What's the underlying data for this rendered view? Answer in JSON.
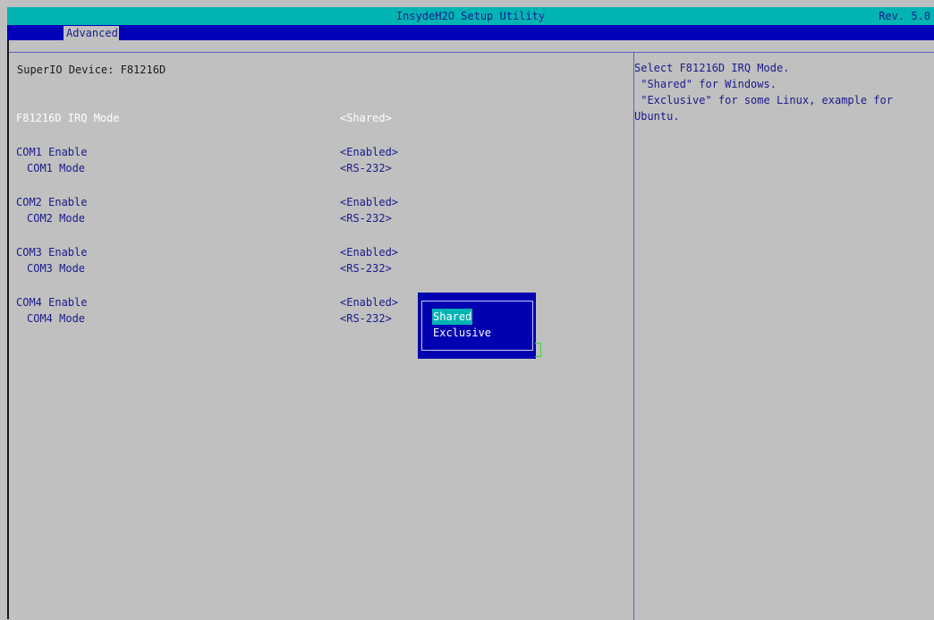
{
  "header": {
    "title": "InsydeH2O Setup Utility",
    "revision": "Rev. 5.0",
    "active_tab": "Advanced"
  },
  "main": {
    "device_title": "SuperIO Device: F81216D",
    "settings": [
      {
        "label": "F81216D IRQ Mode",
        "value": "<Shared>",
        "selected": true,
        "sub": false
      },
      {
        "label": "COM1 Enable",
        "value": "<Enabled>",
        "selected": false,
        "sub": false
      },
      {
        "label": "COM1 Mode",
        "value": "<RS-232>",
        "selected": false,
        "sub": true
      },
      {
        "label": "COM2 Enable",
        "value": "<Enabled>",
        "selected": false,
        "sub": false
      },
      {
        "label": "COM2 Mode",
        "value": "<RS-232>",
        "selected": false,
        "sub": true
      },
      {
        "label": "COM3 Enable",
        "value": "<Enabled>",
        "selected": false,
        "sub": false
      },
      {
        "label": "COM3 Mode",
        "value": "<RS-232>",
        "selected": false,
        "sub": true
      },
      {
        "label": "COM4 Enable",
        "value": "<Enabled>",
        "selected": false,
        "sub": false
      },
      {
        "label": "COM4 Mode",
        "value": "<RS-232>",
        "selected": false,
        "sub": true
      }
    ]
  },
  "popup": {
    "options": [
      "Shared",
      "Exclusive"
    ],
    "highlighted": "Shared"
  },
  "help": {
    "text": "Select F81216D IRQ Mode.\n \"Shared\" for Windows.\n \"Exclusive\" for some Linux, example for\nUbuntu."
  },
  "colors": {
    "title_bar": "#00b4b4",
    "tab_bar": "#0000b8",
    "background": "#c0c0c0",
    "text": "#1a1a8c",
    "selected_text": "#ffffff",
    "popup_bg": "#0000b0",
    "popup_highlight": "#00b4b4"
  }
}
